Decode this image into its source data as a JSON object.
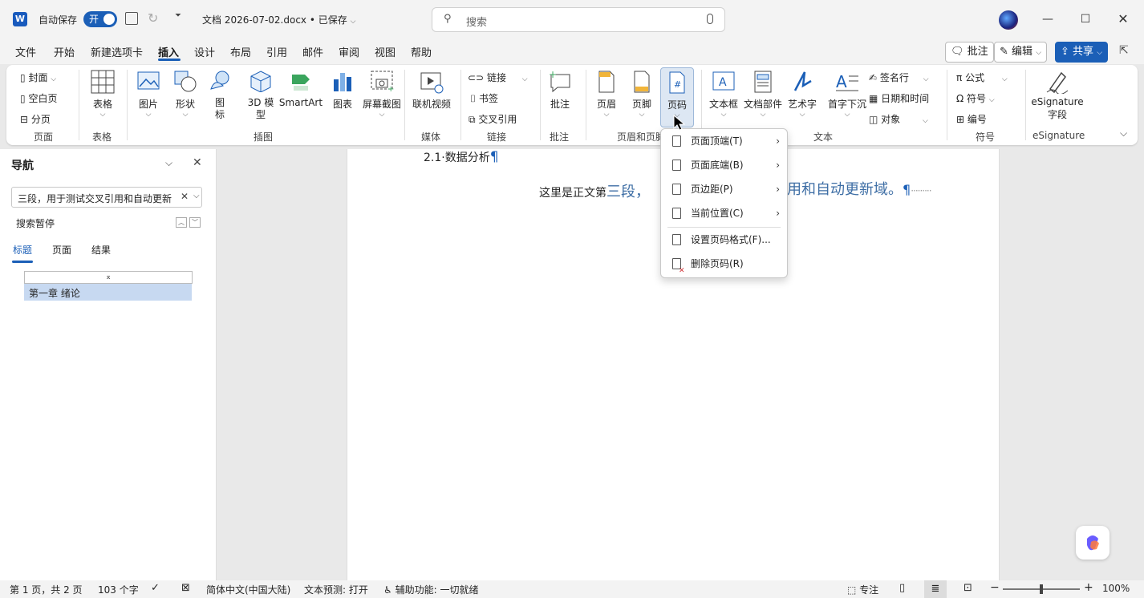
{
  "titlebar": {
    "autosave_label": "自动保存",
    "autosave_state": "开",
    "doc_title": "文档 2026-07-02.docx • 已保存",
    "search_placeholder": "搜索"
  },
  "menu_tabs": [
    "文件",
    "开始",
    "新建选项卡",
    "插入",
    "设计",
    "布局",
    "引用",
    "邮件",
    "审阅",
    "视图",
    "帮助"
  ],
  "active_tab": "插入",
  "right_buttons": {
    "comment": "批注",
    "edit": "编辑",
    "share": "共享"
  },
  "ribbon": {
    "pages": {
      "items": [
        "封面",
        "空白页",
        "分页"
      ],
      "label": "页面"
    },
    "table": {
      "button": "表格",
      "label": "表格"
    },
    "illustrations": {
      "buttons": [
        "图片",
        "形状",
        "图标",
        "3D 模型",
        "SmartArt",
        "图表",
        "屏幕截图"
      ],
      "label": "插图"
    },
    "media": {
      "button": "联机视频",
      "label": "媒体"
    },
    "links": {
      "items": [
        "链接",
        "书签",
        "交叉引用"
      ],
      "label": "链接"
    },
    "comments": {
      "button": "批注",
      "label": "批注"
    },
    "header_footer": {
      "buttons": [
        "页眉",
        "页脚",
        "页码"
      ],
      "label": "页眉和页脚"
    },
    "text": {
      "buttons": [
        "文本框",
        "文档部件",
        "艺术字",
        "首字下沉"
      ],
      "items": [
        "签名行",
        "日期和时间",
        "对象"
      ],
      "label": "文本"
    },
    "symbols": {
      "items": [
        "公式",
        "符号",
        "编号"
      ],
      "label": "符号"
    },
    "esignature": {
      "button_line1": "eSignature",
      "button_line2": "字段",
      "label": "eSignature"
    }
  },
  "nav": {
    "title": "导航",
    "search_value": "三段，用于测试交叉引用和自动更新",
    "search_status": "搜索暂停",
    "tabs": [
      "标题",
      "页面",
      "结果"
    ],
    "active_tab": "标题",
    "headings": [
      "第一章 绪论"
    ]
  },
  "document": {
    "heading": "2.1·数据分析",
    "pilcrow": "¶",
    "body_prefix": "这里是正文第",
    "body_hl1": "三段，",
    "body_hl2": "用和自动更新域。",
    "body_end": "¶"
  },
  "popup_menu": [
    {
      "label": "页面顶端(T)",
      "submenu": true
    },
    {
      "label": "页面底端(B)",
      "submenu": true
    },
    {
      "label": "页边距(P)",
      "submenu": true
    },
    {
      "label": "当前位置(C)",
      "submenu": true
    },
    {
      "label": "设置页码格式(F)...",
      "submenu": false
    },
    {
      "label": "删除页码(R)",
      "submenu": false
    }
  ],
  "status": {
    "page": "第 1 页，共 2 页",
    "words": "103 个字",
    "language": "简体中文(中国大陆)",
    "prediction": "文本预测: 打开",
    "accessibility": "辅助功能: 一切就绪",
    "focus": "专注",
    "zoom": "100%"
  },
  "colors": {
    "accent": "#1b5fb7",
    "highlight_text": "#3e6ea5",
    "nav_selected": "#c7d9f1"
  }
}
